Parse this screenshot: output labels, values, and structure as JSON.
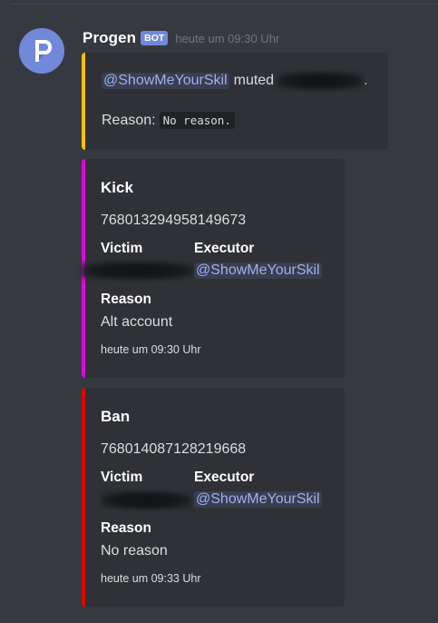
{
  "message": {
    "author": "Progen",
    "bot_tag": "BOT",
    "timestamp": "heute um 09:30 Uhr",
    "avatar_icon": "progen-p-logo-icon",
    "avatar_color": "#7289da"
  },
  "embed_mute": {
    "accent_color": "#f6c000",
    "mention": "@ShowMeYourSkil",
    "action_text": "muted",
    "trailing": ".",
    "reason_label": "Reason:",
    "reason_code": "No reason."
  },
  "embeds": [
    {
      "accent_color": "#e000e0",
      "title": "Kick",
      "id": "768013294958149673",
      "victim_label": "Victim",
      "executor_label": "Executor",
      "executor_mention": "@ShowMeYourSkil",
      "reason_label": "Reason",
      "reason_value": "Alt account",
      "footer": "heute um 09:30 Uhr"
    },
    {
      "accent_color": "#e00000",
      "title": "Ban",
      "id": "768014087128219668",
      "victim_label": "Victim",
      "executor_label": "Executor",
      "executor_mention": "@ShowMeYourSkil",
      "reason_label": "Reason",
      "reason_value": "No reason",
      "footer": "heute um 09:33 Uhr"
    }
  ]
}
